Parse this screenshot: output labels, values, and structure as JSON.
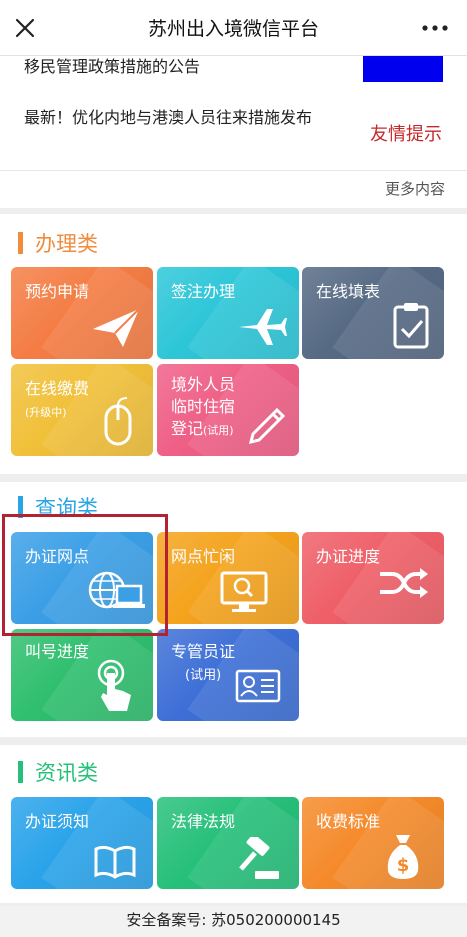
{
  "header": {
    "title": "苏州出入境微信平台",
    "close_icon": "close-icon",
    "more_icon": "more-dots-icon"
  },
  "news": {
    "item1": "移民管理政策措施的公告",
    "item2": "最新！优化内地与港澳人员往来措施发布",
    "tag": "友情提示",
    "more": "更多内容"
  },
  "sections": {
    "handle": {
      "title": "办理类",
      "accent": "#f08c3c",
      "tiles": [
        {
          "label": "预约申请",
          "icon": "paper-plane-icon",
          "color": "#f47d44"
        },
        {
          "label": "签注办理",
          "icon": "airplane-icon",
          "color": "#2cc6d8"
        },
        {
          "label": "在线填表",
          "icon": "clipboard-icon",
          "color": "#566a84"
        },
        {
          "label": "在线缴费",
          "sub": "(升级中)",
          "icon": "mouse-icon",
          "color": "#f1c039"
        },
        {
          "line1": "境外人员",
          "line2": "临时住宿",
          "line3": "登记",
          "sub": "(试用)",
          "icon": "pencil-icon",
          "color": "#ef5f86"
        }
      ]
    },
    "query": {
      "title": "查询类",
      "accent": "#2aa5e3",
      "tiles": [
        {
          "label": "办证网点",
          "icon": "globe-laptop-icon",
          "color": "#3b9fe6"
        },
        {
          "label": "网点忙闲",
          "icon": "monitor-search-icon",
          "color": "#f4a31d"
        },
        {
          "label": "办证进度",
          "icon": "shuffle-icon",
          "color": "#ef5f68"
        },
        {
          "label": "叫号进度",
          "icon": "touch-icon",
          "color": "#2fbf6e"
        },
        {
          "label": "专管员证",
          "sub": "(试用)",
          "icon": "id-card-icon",
          "color": "#3d6fd6"
        }
      ]
    },
    "info": {
      "title": "资讯类",
      "accent": "#27c07a",
      "tiles": [
        {
          "label": "办证须知",
          "icon": "book-icon",
          "color": "#2aa3ea"
        },
        {
          "label": "法律法规",
          "icon": "gavel-icon",
          "color": "#26c07a"
        },
        {
          "label": "收费标准",
          "icon": "money-bag-icon",
          "color": "#f58a2a"
        }
      ]
    }
  },
  "footer": {
    "text": "安全备案号: 苏050200000145"
  }
}
